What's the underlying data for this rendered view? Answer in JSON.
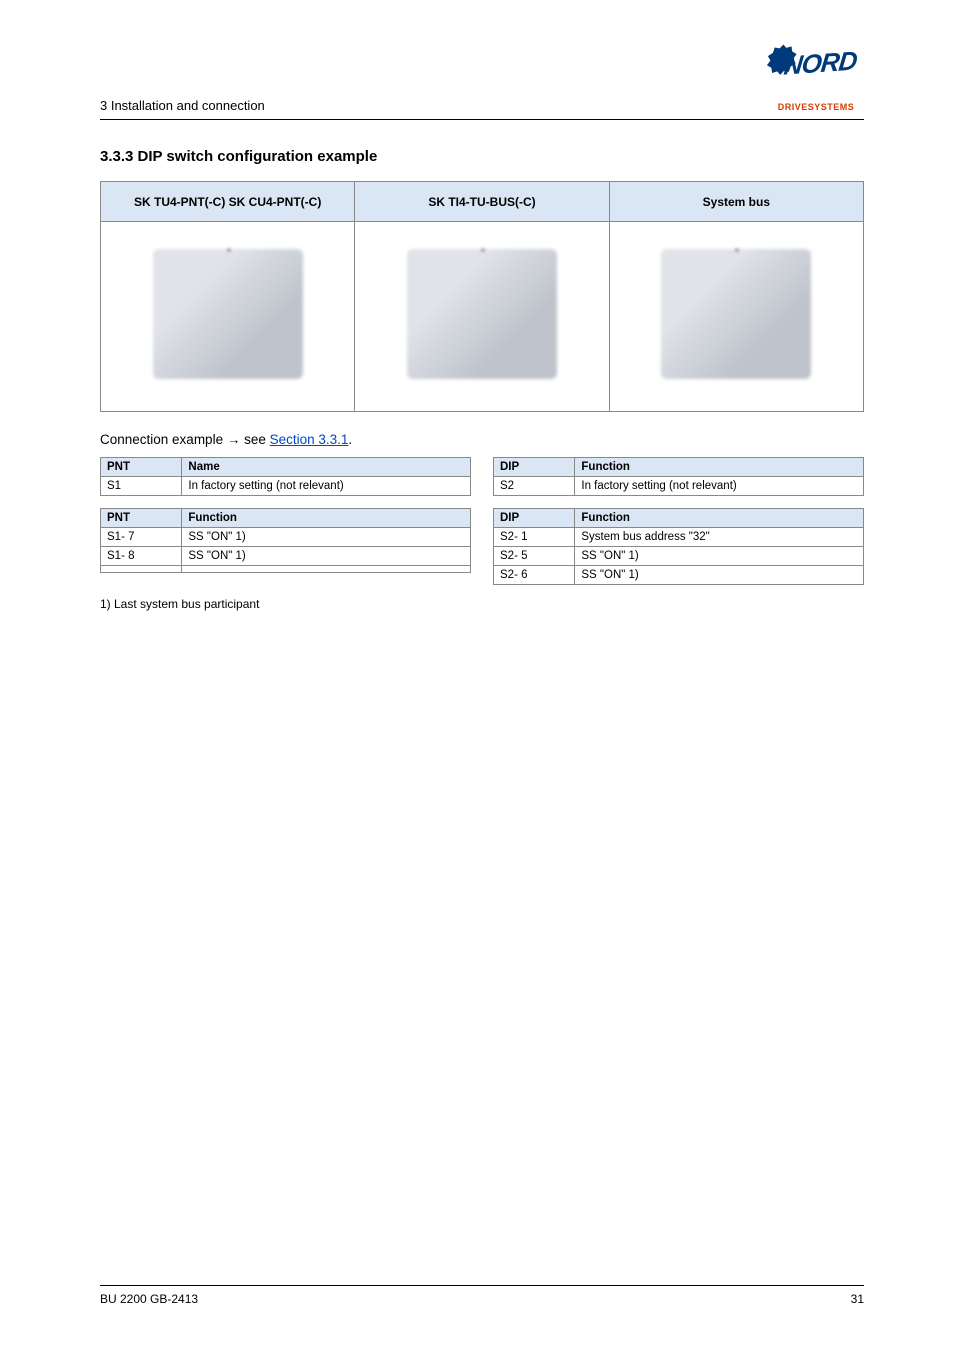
{
  "header": {
    "left": "3 Installation and connection",
    "logo_text": "NORD",
    "logo_sub": "DRIVESYSTEMS"
  },
  "section": {
    "num_title": "3.3.3   DIP switch configuration example"
  },
  "pin_table": {
    "h1": "SK TU4-PNT(-C) SK CU4-PNT(-C)",
    "h2": "SK TI4-TU-BUS(-C)",
    "h3": "System bus"
  },
  "intro": {
    "prefix": "Connection example → see ",
    "link_text": "Section 3.3.1",
    "link_href": "#",
    "suffix": "."
  },
  "tableL1": {
    "h1": "PNT",
    "h2": "Name",
    "r1c1": "S1",
    "r1c2": "In factory setting (not relevant)"
  },
  "tableR1": {
    "h1": "DIP",
    "h2": "Function",
    "r1c1": "S2",
    "r1c2": "In factory setting (not relevant)"
  },
  "tableL2": {
    "h1": "PNT",
    "h2": "Function",
    "r1c1": "S1- 7",
    "r1c2": "SS  \"ON\" 1)",
    "r2c1": "S1- 8",
    "r2c2": "SS  \"ON\" 1)",
    "r3c1": "",
    "r3c2": ""
  },
  "tableR2": {
    "h1": "DIP",
    "h2": "Function",
    "r1c1": "S2- 1",
    "r1c2": "System bus address \"32\"",
    "r2c1": "S2- 5",
    "r2c2": "SS  \"ON\" 1)",
    "r3c1": "S2- 6",
    "r3c2": "SS  \"ON\" 1)"
  },
  "caption": "1)      Last system bus participant",
  "footer": {
    "left": "BU 2200 GB-2413",
    "right": "31"
  }
}
